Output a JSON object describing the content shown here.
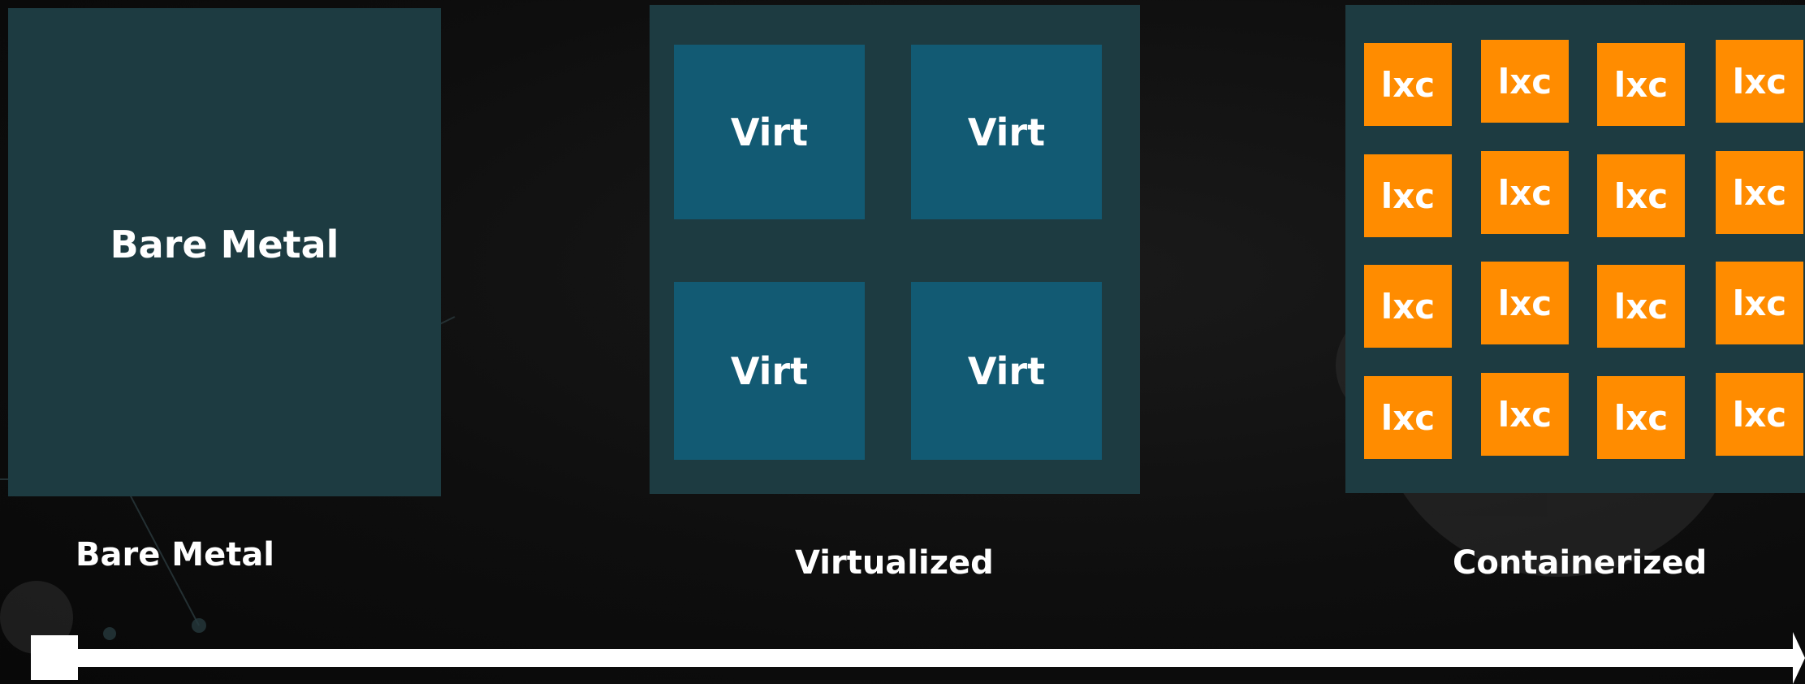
{
  "bare_metal": {
    "box_label": "Bare Metal",
    "caption": "Bare Metal"
  },
  "virtualized": {
    "tiles": [
      "Virt",
      "Virt",
      "Virt",
      "Virt"
    ],
    "caption": "Virtualized"
  },
  "containerized": {
    "tiles": [
      "lxc",
      "lxc",
      "lxc",
      "lxc",
      "lxc",
      "lxc",
      "lxc",
      "lxc",
      "lxc",
      "lxc",
      "lxc",
      "lxc",
      "lxc",
      "lxc",
      "lxc",
      "lxc"
    ],
    "caption": "Containerized"
  },
  "colors": {
    "panel": "#1d3b41",
    "virt_tile": "#125a73",
    "lxc_tile": "#ff8c00",
    "background": "#0e0e0e",
    "text": "#ffffff"
  }
}
